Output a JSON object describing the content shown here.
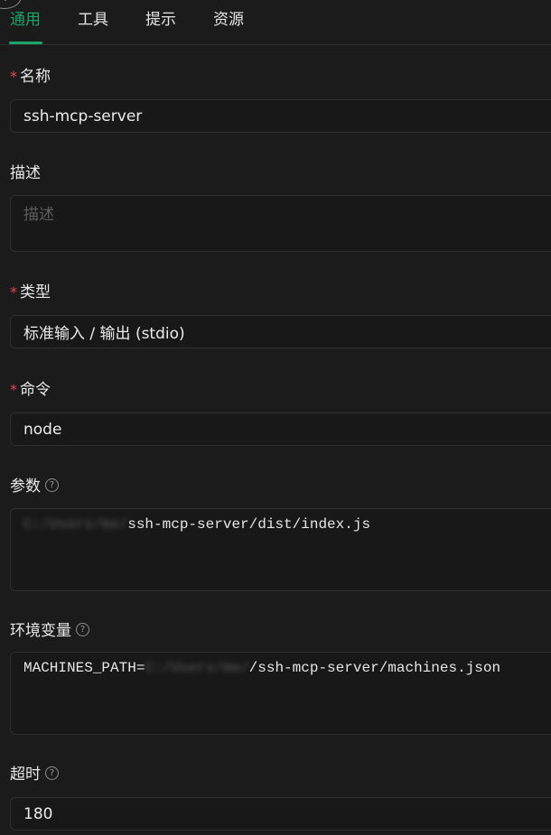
{
  "tabs": [
    {
      "label": "通用",
      "active": true
    },
    {
      "label": "工具",
      "active": false
    },
    {
      "label": "提示",
      "active": false
    },
    {
      "label": "资源",
      "active": false
    }
  ],
  "colors": {
    "accent": "#1aa56b",
    "required": "#e5484d",
    "background": "#1b1b1b"
  },
  "form": {
    "required_mark": "*",
    "help_glyph": "?",
    "name": {
      "label": "名称",
      "required": true,
      "value": "ssh-mcp-server"
    },
    "description": {
      "label": "描述",
      "required": false,
      "placeholder": "描述",
      "value": ""
    },
    "type": {
      "label": "类型",
      "required": true,
      "value": "标准输入 / 输出 (stdio)"
    },
    "command": {
      "label": "命令",
      "required": true,
      "value": "node"
    },
    "args": {
      "label": "参数",
      "has_help": true,
      "value_prefix_redacted": "C:/Users/me/",
      "value": "ssh-mcp-server/dist/index.js"
    },
    "env": {
      "label": "环境变量",
      "has_help": true,
      "key": "MACHINES_PATH=",
      "value_prefix_redacted": "C:/Users/me/",
      "value": "/ssh-mcp-server/machines.json"
    },
    "timeout": {
      "label": "超时",
      "has_help": true,
      "value": "180"
    }
  },
  "icons": {
    "back": "chevron-left-icon",
    "help": "question-circle-icon"
  }
}
